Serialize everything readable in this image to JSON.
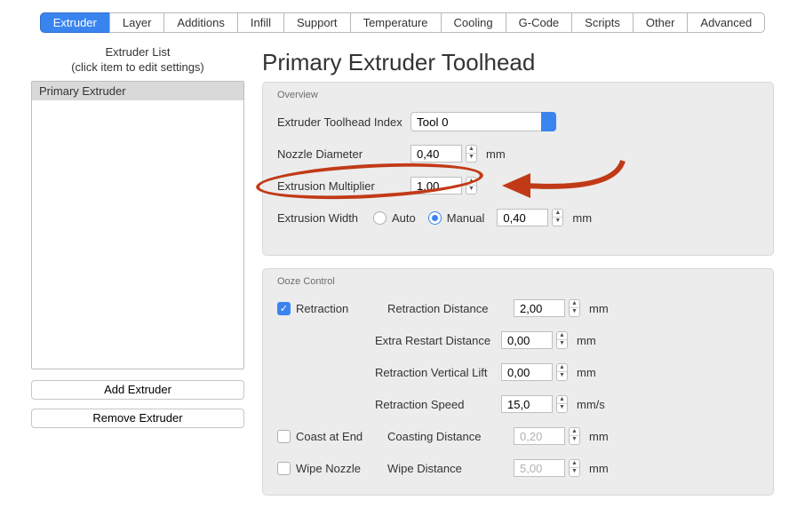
{
  "tabs": [
    "Extruder",
    "Layer",
    "Additions",
    "Infill",
    "Support",
    "Temperature",
    "Cooling",
    "G-Code",
    "Scripts",
    "Other",
    "Advanced"
  ],
  "activeTab": 0,
  "sidebar": {
    "heading_line1": "Extruder List",
    "heading_line2": "(click item to edit settings)",
    "items": [
      "Primary Extruder"
    ],
    "add_label": "Add Extruder",
    "remove_label": "Remove Extruder"
  },
  "main": {
    "title": "Primary Extruder Toolhead",
    "overview": {
      "legend": "Overview",
      "toolhead_label": "Extruder Toolhead Index",
      "toolhead_value": "Tool 0",
      "nozzle_label": "Nozzle Diameter",
      "nozzle_value": "0,40",
      "nozzle_unit": "mm",
      "multiplier_label": "Extrusion Multiplier",
      "multiplier_value": "1,00",
      "width_label": "Extrusion Width",
      "width_auto": "Auto",
      "width_manual": "Manual",
      "width_mode": "manual",
      "width_value": "0,40",
      "width_unit": "mm"
    },
    "ooze": {
      "legend": "Ooze Control",
      "retraction_label": "Retraction",
      "retraction_checked": true,
      "coast_label": "Coast at End",
      "coast_checked": false,
      "wipe_label": "Wipe Nozzle",
      "wipe_checked": false,
      "fields": {
        "retraction_distance": {
          "label": "Retraction Distance",
          "value": "2,00",
          "unit": "mm"
        },
        "extra_restart": {
          "label": "Extra Restart Distance",
          "value": "0,00",
          "unit": "mm"
        },
        "vertical_lift": {
          "label": "Retraction Vertical Lift",
          "value": "0,00",
          "unit": "mm"
        },
        "retraction_speed": {
          "label": "Retraction Speed",
          "value": "15,0",
          "unit": "mm/s"
        },
        "coasting_distance": {
          "label": "Coasting Distance",
          "value": "0,20",
          "unit": "mm"
        },
        "wipe_distance": {
          "label": "Wipe Distance",
          "value": "5,00",
          "unit": "mm"
        }
      }
    }
  }
}
